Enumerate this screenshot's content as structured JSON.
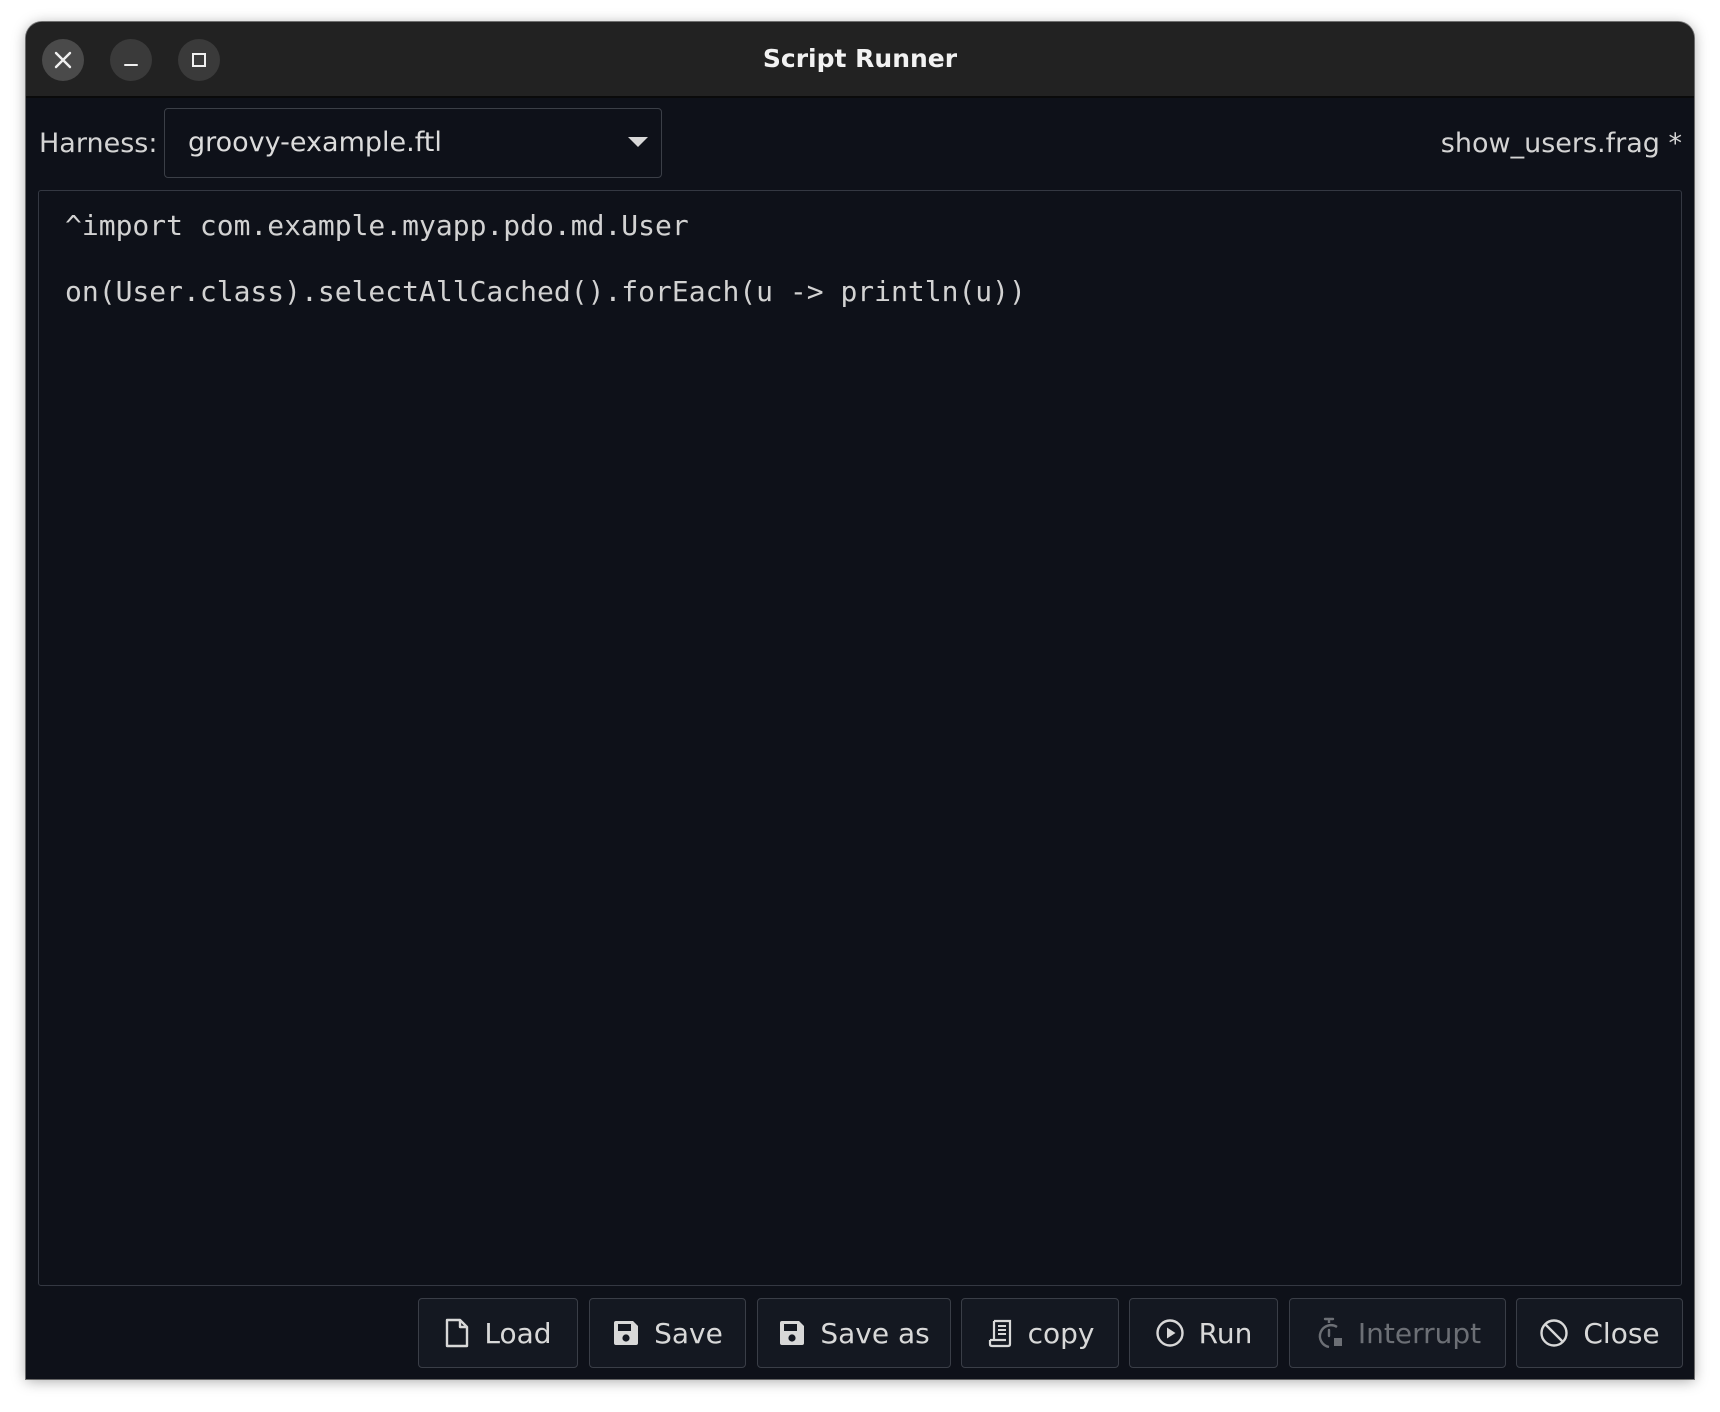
{
  "window": {
    "title": "Script Runner"
  },
  "toolbar": {
    "harness_label": "Harness:",
    "harness_value": "groovy-example.ftl",
    "filename": "show_users.frag *"
  },
  "editor": {
    "lines": [
      "^import com.example.myapp.pdo.md.User",
      "",
      "on(User.class).selectAllCached().forEach(u -> println(u))"
    ]
  },
  "buttons": {
    "load": "Load",
    "save": "Save",
    "save_as": "Save as",
    "copy": "copy",
    "run": "Run",
    "interrupt": "Interrupt",
    "close": "Close"
  },
  "icons": {
    "window_close": "close-icon",
    "window_minimize": "minimize-icon",
    "window_maximize": "maximize-icon",
    "load": "file-icon",
    "save": "floppy-disk-icon",
    "save_as": "floppy-disk-icon",
    "copy": "clipboard-icon",
    "run": "play-circle-icon",
    "interrupt": "stopwatch-icon",
    "close": "ban-icon"
  },
  "colors": {
    "background": "#0e1119",
    "titlebar": "#222222",
    "text": "#d4d4d4",
    "disabled_text": "#6c6f75"
  }
}
